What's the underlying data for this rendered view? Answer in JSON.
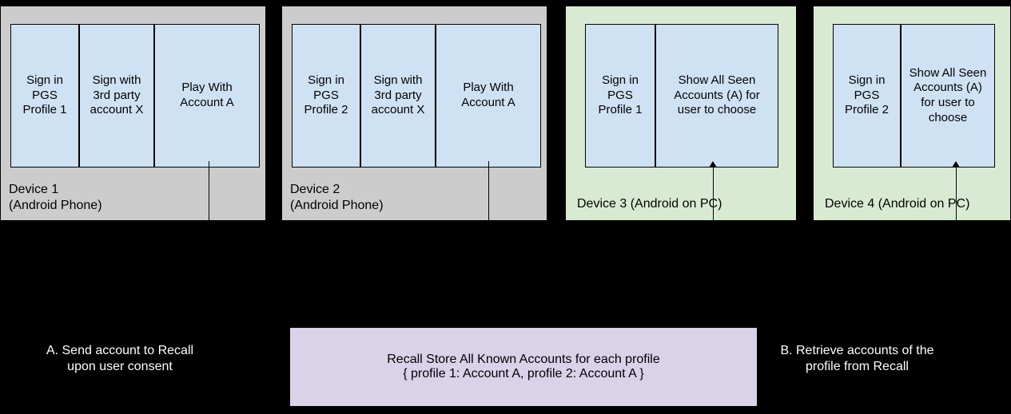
{
  "devices": [
    {
      "label": "Device 1\n(Android Phone)",
      "steps": [
        "Sign in PGS Profile 1",
        "Sign with 3rd party account X",
        "Play With Account A"
      ]
    },
    {
      "label": "Device 2\n(Android Phone)",
      "steps": [
        "Sign in PGS Profile 2",
        "Sign with 3rd party account X",
        "Play With Account A"
      ]
    },
    {
      "label": "Device 3 (Android on PC)",
      "steps": [
        "Sign in PGS Profile 1",
        "Show All Seen Accounts (A) for user to choose"
      ]
    },
    {
      "label": "Device 4 (Android on PC)",
      "steps": [
        "Sign in PGS Profile 2",
        "Show All Seen Accounts (A) for user to choose"
      ]
    }
  ],
  "store": {
    "label": "Recall Store All Known Accounts for each profile\n{ profile 1: Account A, profile 2: Account A }"
  },
  "captions": {
    "A": "A. Send account to Recall upon user consent",
    "B": "B. Retrieve accounts of the profile from Recall"
  }
}
